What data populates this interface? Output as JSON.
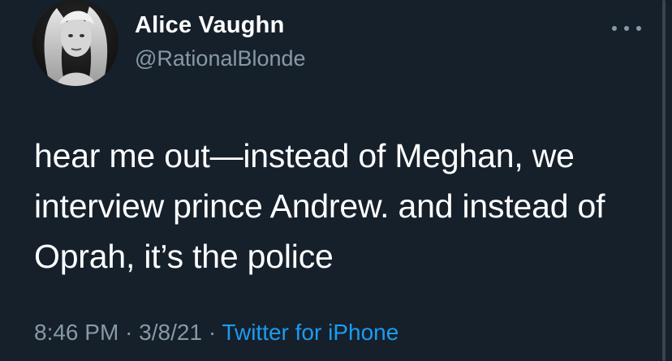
{
  "tweet": {
    "display_name": "Alice Vaughn",
    "handle": "@RationalBlonde",
    "text": "hear me out—instead of Meghan, we interview prince Andrew. and instead of Oprah, it’s the police",
    "time": "8:46 PM",
    "separator": "·",
    "date": "3/8/21",
    "source": "Twitter for iPhone"
  },
  "icons": {
    "more": "more-horizontal-icon"
  },
  "colors": {
    "background": "#15202b",
    "primary_text": "#ffffff",
    "secondary_text": "#8899a6",
    "link": "#1d9bf0"
  }
}
